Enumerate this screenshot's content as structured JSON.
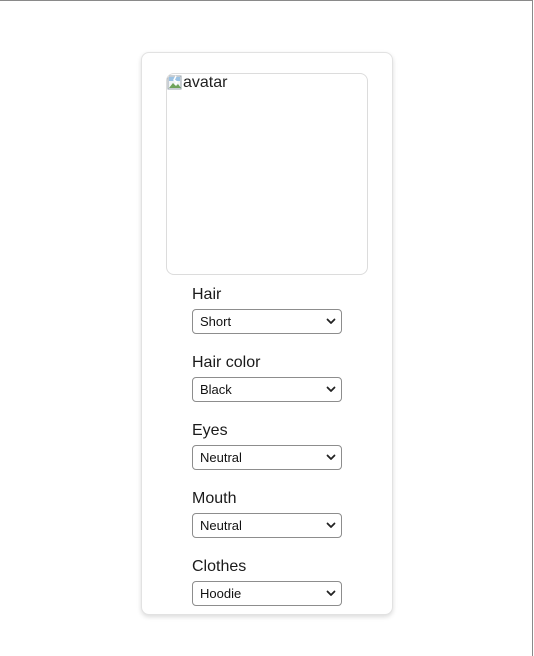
{
  "avatar": {
    "alt_text": "avatar",
    "icon": "broken-image-icon"
  },
  "controls": [
    {
      "label": "Hair",
      "value": "Short"
    },
    {
      "label": "Hair color",
      "value": "Black"
    },
    {
      "label": "Eyes",
      "value": "Neutral"
    },
    {
      "label": "Mouth",
      "value": "Neutral"
    },
    {
      "label": "Clothes",
      "value": "Hoodie"
    }
  ],
  "colors": {
    "card_border": "#e2e2e2",
    "select_border": "#8d8d8d",
    "text": "#1a1a1a"
  }
}
